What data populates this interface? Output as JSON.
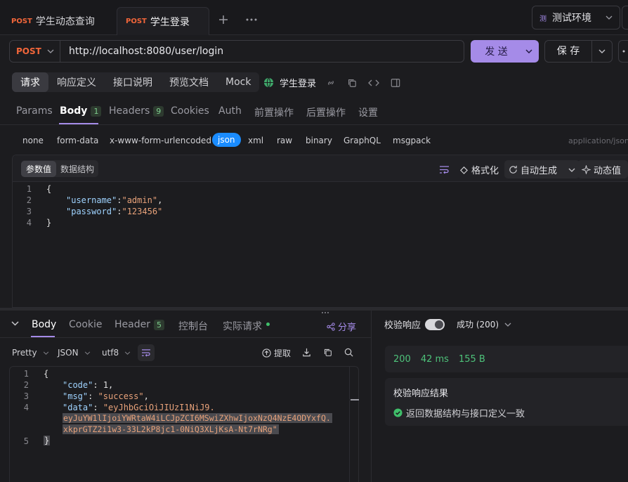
{
  "tabs": [
    {
      "method": "POST",
      "label": "学生动态查询"
    },
    {
      "method": "POST",
      "label": "学生登录"
    }
  ],
  "env": {
    "icon_char": "测",
    "label": "测试环境"
  },
  "request": {
    "method": "POST",
    "url": "http://localhost:8080/user/login",
    "send_label": "发 送",
    "save_label": "保 存",
    "name": "学生登录"
  },
  "section_tabs": [
    "请求",
    "响应定义",
    "接口说明",
    "预览文档",
    "Mock"
  ],
  "param_tabs": [
    {
      "label": "Params"
    },
    {
      "label": "Body",
      "count": "1"
    },
    {
      "label": "Headers",
      "count": "9"
    },
    {
      "label": "Cookies"
    },
    {
      "label": "Auth"
    },
    {
      "label": "前置操作"
    },
    {
      "label": "后置操作"
    },
    {
      "label": "设置"
    }
  ],
  "body_types": [
    "none",
    "form-data",
    "x-www-form-urlencoded",
    "json",
    "xml",
    "raw",
    "binary",
    "GraphQL",
    "msgpack"
  ],
  "content_type": "application/json",
  "editor_tools": {
    "mode_value": "参数值",
    "mode_schema": "数据结构",
    "format": "格式化",
    "auto_gen": "自动生成",
    "dynamic": "动态值"
  },
  "request_body": {
    "line_numbers": [
      "1",
      "2",
      "3",
      "4"
    ],
    "open": "{",
    "close": "}",
    "k1": "\"username\"",
    "v1": "\"admin\"",
    "k2": "\"password\"",
    "v2": "\"123456\""
  },
  "response": {
    "tabs": [
      {
        "label": "Body"
      },
      {
        "label": "Cookie"
      },
      {
        "label": "Header",
        "count": "5"
      },
      {
        "label": "控制台"
      },
      {
        "label": "实际请求"
      }
    ],
    "share": "分享",
    "format": "Pretty",
    "lang": "JSON",
    "encoding": "utf8",
    "extract": "提取",
    "line_numbers": [
      "1",
      "2",
      "3",
      "4",
      "5"
    ],
    "open": "{",
    "close": "}",
    "k_code": "\"code\"",
    "v_code": "1",
    "k_msg": "\"msg\"",
    "v_msg": "\"success\"",
    "k_data": "\"data\"",
    "v_data_1": "\"eyJhbGciOiJIUzI1NiJ9.",
    "v_data_2": "eyJuYW1lIjoiYWRtaW4iLCJpZCI6MSwiZXhwIjoxNzQ4NzE4ODYxfQ.",
    "v_data_3": "xkprGTZ2i1w3-33L2kP8jc1-0NiQ3XLjKsA-Nt7rNRg\""
  },
  "validation": {
    "label": "校验响应",
    "status": "成功 (200)",
    "code": "200",
    "time": "42 ms",
    "size": "155 B",
    "result_title": "校验响应结果",
    "result_text": "返回数据结构与接口定义一致"
  }
}
